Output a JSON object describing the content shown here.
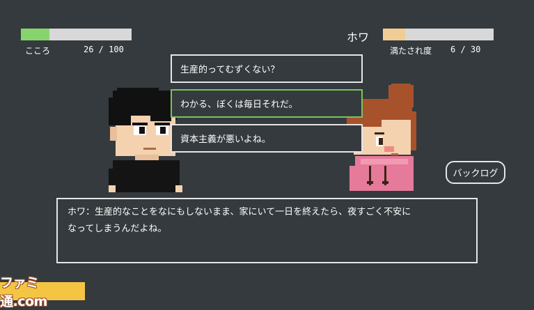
{
  "kokoro": {
    "label": "こころ",
    "value_text": "26 / 100",
    "fraction": 0.26,
    "color": "#88d46c"
  },
  "partner": {
    "name": "ホワ",
    "label": "満たされ度",
    "value_text": "6 / 30",
    "fraction": 0.2,
    "color": "#f2cc96"
  },
  "choices": [
    {
      "text": "生産的ってむずくない？",
      "selected": false
    },
    {
      "text": "わかる、ぼくは毎日それだ。",
      "selected": true
    },
    {
      "text": "資本主義が悪いよね。",
      "selected": false
    }
  ],
  "backlog_label": "バックログ",
  "dialogue": {
    "line1": "ホワ：生産的なことをなにもしないまま、家にいて一日を終えたら、夜すごく不安に",
    "line2": "なってしまうんだよね。"
  },
  "watermark": "ファミ通.com",
  "colors": {
    "background": "#343a3e",
    "selected_border": "#7dc35c",
    "border": "#e6e6e6"
  }
}
